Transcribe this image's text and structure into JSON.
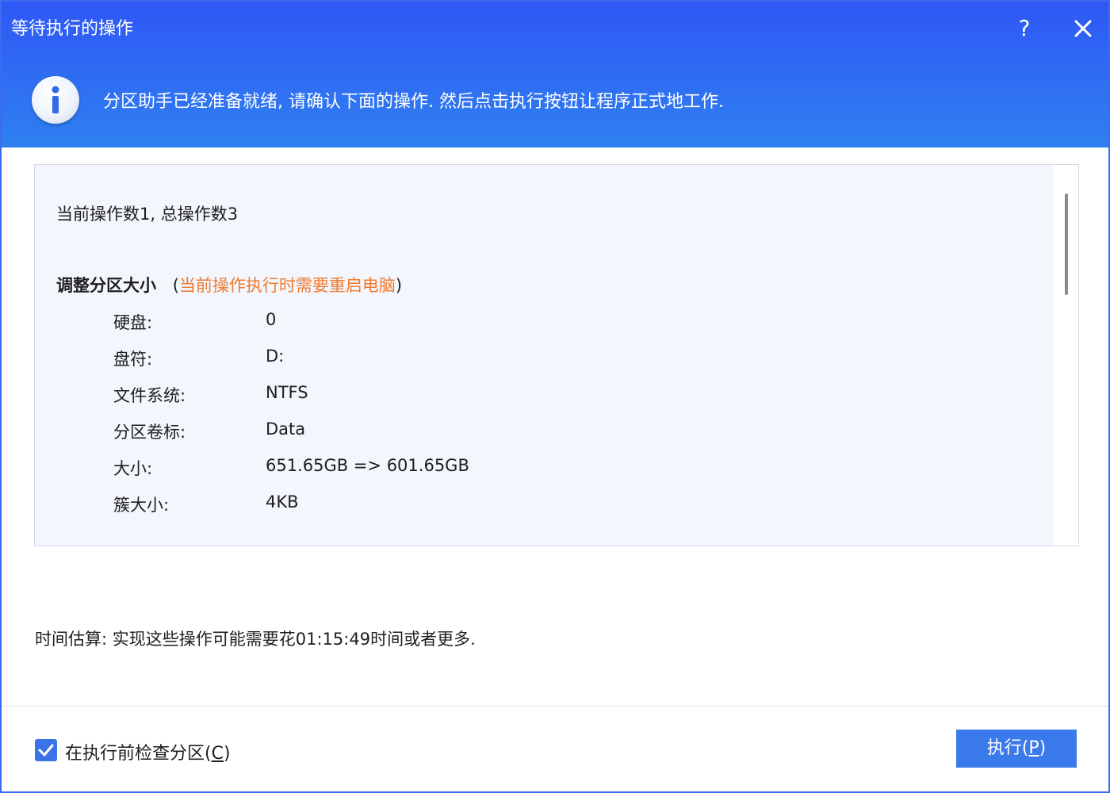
{
  "window": {
    "title": "等待执行的操作",
    "help_label": "?",
    "close_icon": "close-icon"
  },
  "header": {
    "info_icon": "info-icon",
    "message": "分区助手已经准备就绪, 请确认下面的操作. 然后点击执行按钮让程序正式地工作."
  },
  "operations": {
    "count_text": "当前操作数1, 总操作数3",
    "current": {
      "name": "调整分区大小",
      "paren_open": "(",
      "warning": "当前操作执行时需要重启电脑",
      "paren_close": ")",
      "properties": [
        {
          "label": "硬盘:",
          "value": "0"
        },
        {
          "label": "盘符:",
          "value": "D:"
        },
        {
          "label": "文件系统:",
          "value": "NTFS"
        },
        {
          "label": "分区卷标:",
          "value": "Data"
        },
        {
          "label": "大小:",
          "value": "651.65GB => 601.65GB"
        },
        {
          "label": "簇大小:",
          "value": "4KB"
        }
      ]
    }
  },
  "estimate": {
    "text": "时间估算: 实现这些操作可能需要花01:15:49时间或者更多."
  },
  "footer": {
    "check_before": {
      "checked": true,
      "label": "在执行前检查分区(",
      "mnemonic": "C",
      "label_end": ")"
    },
    "execute": {
      "label": "执行(",
      "mnemonic": "P",
      "label_end": ")"
    }
  },
  "colors": {
    "header_top": "#2f57f5",
    "header_bottom": "#2f80f0",
    "warning": "#f07a2e",
    "button": "#3a7aea",
    "panel_bg": "#f3f6fc"
  }
}
